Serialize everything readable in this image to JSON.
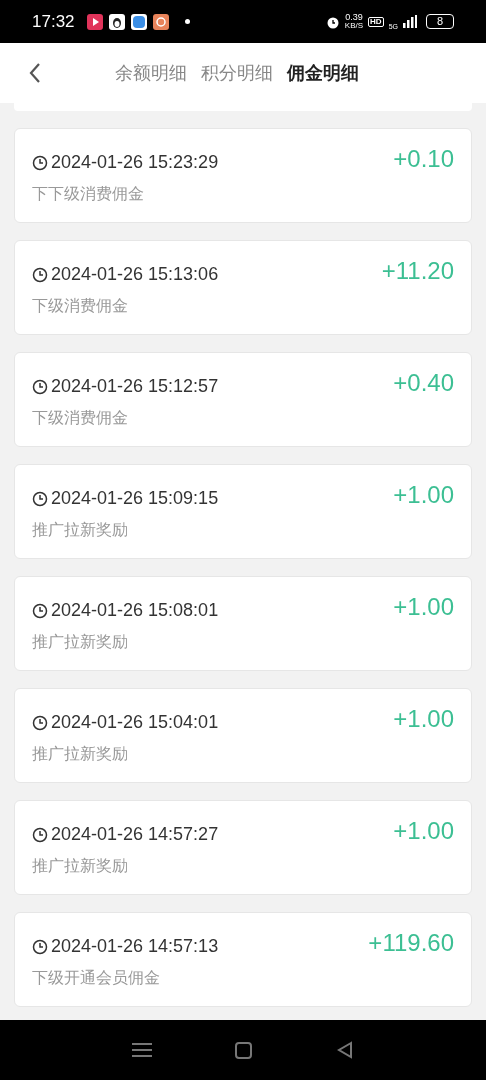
{
  "status_bar": {
    "time": "17:32",
    "net_speed": "0.39",
    "net_unit": "KB/S",
    "hd": "HD",
    "network": "5G",
    "battery": "8"
  },
  "tabs": [
    {
      "label": "余额明细",
      "selected": false
    },
    {
      "label": "积分明细",
      "selected": false
    },
    {
      "label": "佣金明细",
      "selected": true
    }
  ],
  "records": [
    {
      "time": "2024-01-26 15:23:29",
      "type": "下下级消费佣金",
      "amount": "+0.10"
    },
    {
      "time": "2024-01-26 15:13:06",
      "type": "下级消费佣金",
      "amount": "+11.20"
    },
    {
      "time": "2024-01-26 15:12:57",
      "type": "下级消费佣金",
      "amount": "+0.40"
    },
    {
      "time": "2024-01-26 15:09:15",
      "type": "推广拉新奖励",
      "amount": "+1.00"
    },
    {
      "time": "2024-01-26 15:08:01",
      "type": "推广拉新奖励",
      "amount": "+1.00"
    },
    {
      "time": "2024-01-26 15:04:01",
      "type": "推广拉新奖励",
      "amount": "+1.00"
    },
    {
      "time": "2024-01-26 14:57:27",
      "type": "推广拉新奖励",
      "amount": "+1.00"
    },
    {
      "time": "2024-01-26 14:57:13",
      "type": "下级开通会员佣金",
      "amount": "+119.60"
    }
  ]
}
